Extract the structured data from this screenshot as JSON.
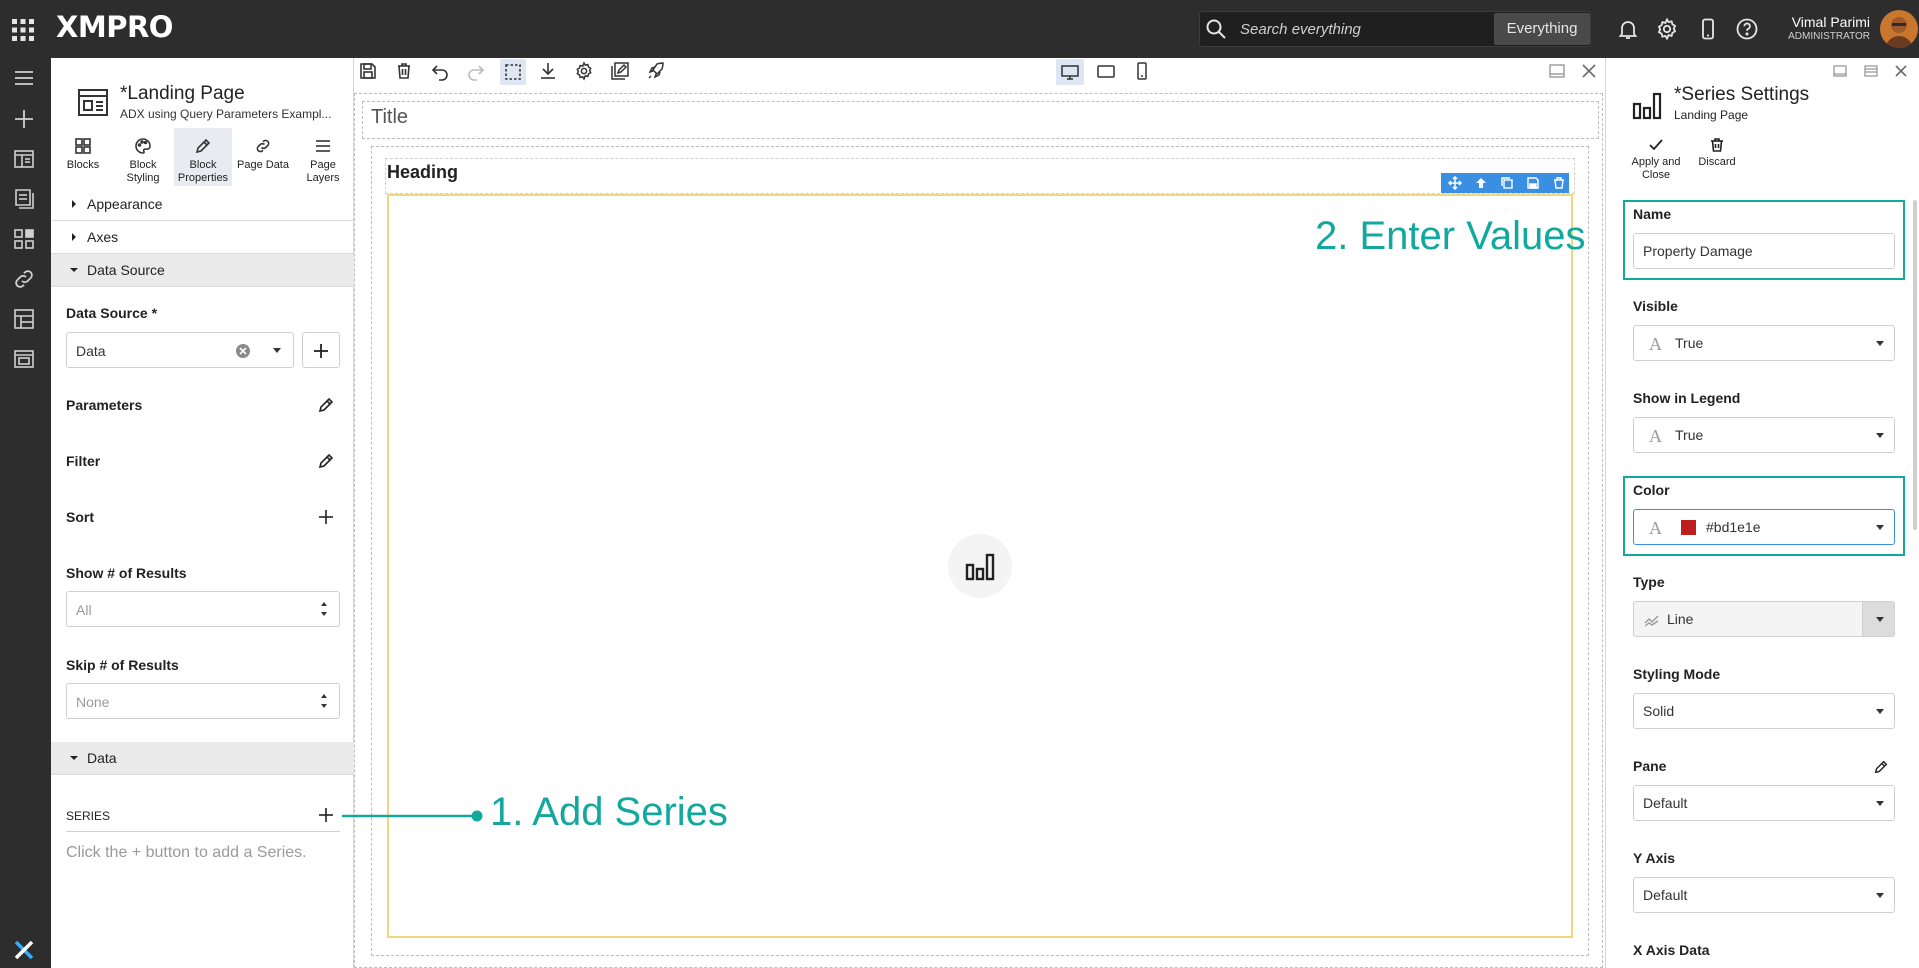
{
  "app": {
    "logo": "XMPRO",
    "search": {
      "placeholder": "Search everything",
      "scope": "Everything"
    },
    "user": {
      "name": "Vimal Parimi",
      "role": "ADMINISTRATOR"
    }
  },
  "left_panel": {
    "page_title": "*Landing Page",
    "page_subtitle": "ADX using Query Parameters Exampl...",
    "tabs": [
      {
        "label": "Blocks",
        "icon": "blocks-icon"
      },
      {
        "label": "Block Styling",
        "icon": "palette-icon"
      },
      {
        "label": "Block Properties",
        "icon": "pencil-icon",
        "active": true
      },
      {
        "label": "Page Data",
        "icon": "link-icon"
      },
      {
        "label": "Page Layers",
        "icon": "layers-icon"
      }
    ],
    "sections": {
      "appearance": "Appearance",
      "axes": "Axes",
      "data_source": "Data Source",
      "data": "Data"
    },
    "data_source_label": "Data Source *",
    "data_source_value": "Data",
    "parameters": "Parameters",
    "filter": "Filter",
    "sort": "Sort",
    "show_results_label": "Show # of Results",
    "show_results_value": "All",
    "skip_results_label": "Skip # of Results",
    "skip_results_value": "None",
    "series_label": "SERIES",
    "series_hint": "Click the + button to add a Series."
  },
  "canvas": {
    "title": "Title",
    "heading": "Heading"
  },
  "annotations": {
    "add_series": "1. Add Series",
    "enter_values": "2. Enter Values",
    "color": "#13a89e"
  },
  "right_panel": {
    "title": "*Series Settings",
    "subtitle": "Landing Page",
    "apply_label": "Apply and Close",
    "discard_label": "Discard",
    "name_label": "Name",
    "name_value": "Property Damage",
    "visible_label": "Visible",
    "visible_value": "True",
    "legend_label": "Show in Legend",
    "legend_value": "True",
    "color_label": "Color",
    "color_value": "#bd1e1e",
    "type_label": "Type",
    "type_value": "Line",
    "styling_label": "Styling Mode",
    "styling_value": "Solid",
    "pane_label": "Pane",
    "pane_value": "Default",
    "yaxis_label": "Y Axis",
    "yaxis_value": "Default",
    "xaxis_label": "X Axis Data"
  }
}
